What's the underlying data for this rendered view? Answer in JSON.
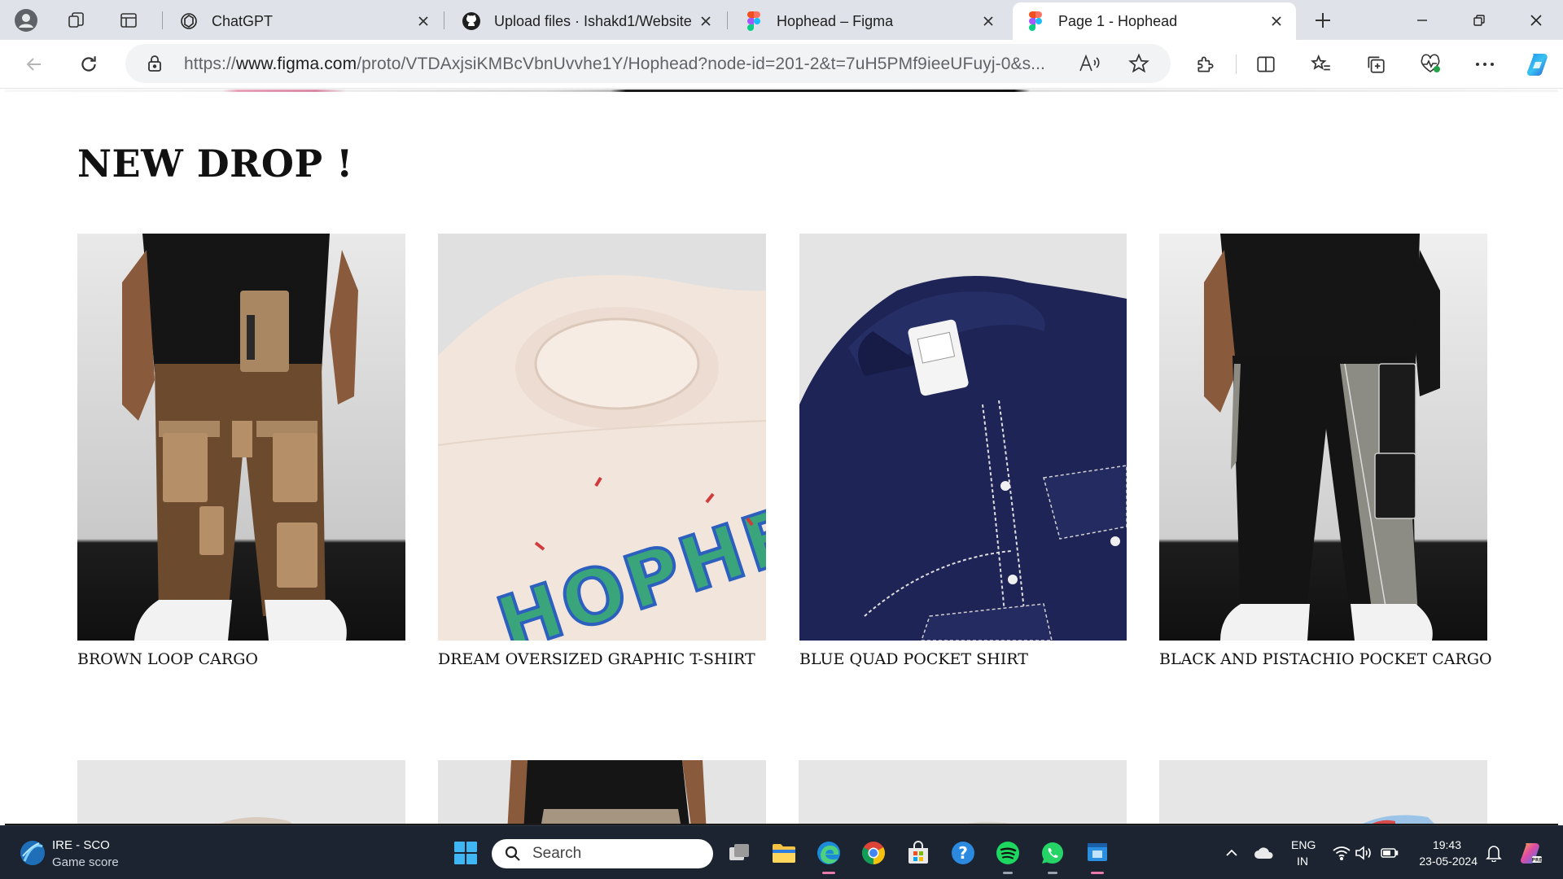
{
  "browser": {
    "tabs": [
      {
        "title": "ChatGPT",
        "favicon": "chatgpt-icon",
        "active": false
      },
      {
        "title": "Upload files · Ishakd1/Website",
        "favicon": "github-icon",
        "active": false
      },
      {
        "title": "Hophead – Figma",
        "favicon": "figma-icon",
        "active": false
      },
      {
        "title": "Page 1 - Hophead",
        "favicon": "figma-icon",
        "active": true
      }
    ],
    "url": {
      "scheme": "https://",
      "domain": "www.figma.com",
      "path": "/proto/VTDAxjsiKMBcVbnUvvhe1Y/Hophead?node-id=201-2&t=7uH5PMf9ieeUFuyj-0&s..."
    }
  },
  "page": {
    "headline": "NEW DROP !",
    "products": [
      {
        "name": "BROWN LOOP CARGO",
        "image": "brown-cargo-pants-photo"
      },
      {
        "name": "DREAM OVERSIZED GRAPHIC T-SHIRT",
        "image": "cream-graphic-tshirt-photo"
      },
      {
        "name": "BLUE QUAD POCKET SHIRT",
        "image": "navy-pocket-shirt-photo"
      },
      {
        "name": "BLACK AND PISTACHIO POCKET CARGO",
        "image": "black-pistachio-cargo-photo"
      }
    ],
    "tshirt_print": "HOPHEAD"
  },
  "taskbar": {
    "widget": {
      "title": "IRE - SCO",
      "subtitle": "Game score"
    },
    "search_label": "Search",
    "language": {
      "line1": "ENG",
      "line2": "IN"
    },
    "clock": {
      "time": "19:43",
      "date": "23-05-2024"
    }
  },
  "colors": {
    "tabstrip": "#dfe3e9",
    "taskbar": "#1b2430",
    "accent": "#1a73e8"
  }
}
